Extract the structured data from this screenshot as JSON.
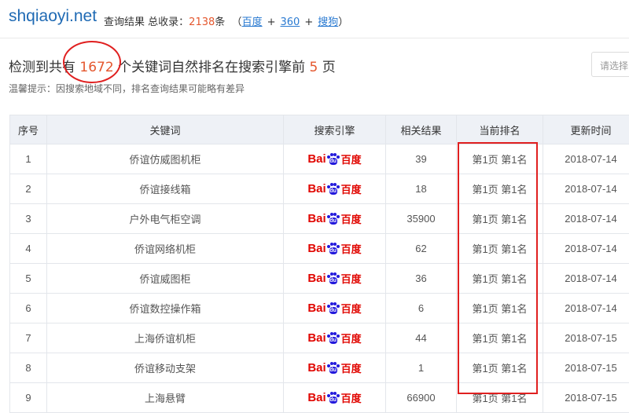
{
  "header": {
    "site": "shqiaoyi.net",
    "label_query": "查询结果",
    "label_total": "总收录：",
    "total_count": "2138",
    "label_unit": "条",
    "paren_open": "（",
    "paren_close": "）",
    "plus": "+",
    "engines": [
      "百度",
      "360",
      "搜狗"
    ]
  },
  "summary": {
    "prefix": "检测到共有",
    "count": "1672",
    "middle": "个关键词自然排名在搜索引擎前",
    "pages": "5",
    "suffix": "页"
  },
  "hint": "温馨提示：因搜索地域不同，排名查询结果可能略有差异",
  "engine_select": {
    "placeholder": "请选择"
  },
  "table": {
    "headers": [
      "序号",
      "关键词",
      "搜索引擎",
      "相关结果",
      "当前排名",
      "更新时间"
    ],
    "rows": [
      {
        "no": "1",
        "keyword": "侨谊仿威图机柜",
        "results": "39",
        "rank": "第1页 第1名",
        "date": "2018-07-14"
      },
      {
        "no": "2",
        "keyword": "侨谊接线箱",
        "results": "18",
        "rank": "第1页 第1名",
        "date": "2018-07-14"
      },
      {
        "no": "3",
        "keyword": "户外电气柜空调",
        "results": "35900",
        "rank": "第1页 第1名",
        "date": "2018-07-14"
      },
      {
        "no": "4",
        "keyword": "侨谊网络机柜",
        "results": "62",
        "rank": "第1页 第1名",
        "date": "2018-07-14"
      },
      {
        "no": "5",
        "keyword": "侨谊威图柜",
        "results": "36",
        "rank": "第1页 第1名",
        "date": "2018-07-14"
      },
      {
        "no": "6",
        "keyword": "侨谊数控操作箱",
        "results": "6",
        "rank": "第1页 第1名",
        "date": "2018-07-14"
      },
      {
        "no": "7",
        "keyword": "上海侨谊机柜",
        "results": "44",
        "rank": "第1页 第1名",
        "date": "2018-07-15"
      },
      {
        "no": "8",
        "keyword": "侨谊移动支架",
        "results": "1",
        "rank": "第1页 第1名",
        "date": "2018-07-15"
      },
      {
        "no": "9",
        "keyword": "上海悬臂",
        "results": "66900",
        "rank": "第1页 第1名",
        "date": "2018-07-15"
      }
    ]
  },
  "logo": {
    "bai": "Bai",
    "du": "du",
    "cn": "百度",
    "icon": "baidu-paw-icon"
  },
  "colors": {
    "accent": "#e4572e",
    "link": "#2a7ad1",
    "highlight": "#e02020",
    "baidu_red": "#e10601",
    "baidu_blue": "#2319dc",
    "header_bg": "#eef1f6"
  }
}
